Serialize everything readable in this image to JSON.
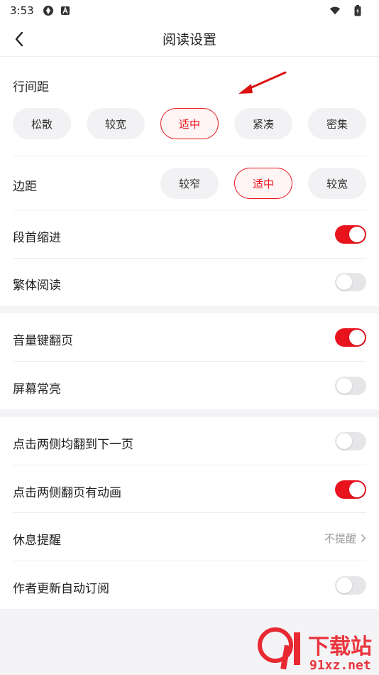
{
  "status_bar": {
    "time": "3:53"
  },
  "header": {
    "title": "阅读设置"
  },
  "line_spacing": {
    "label": "行间距",
    "options": [
      "松散",
      "较宽",
      "适中",
      "紧凑",
      "密集"
    ],
    "selected": "适中"
  },
  "margin": {
    "label": "边距",
    "options": [
      "较窄",
      "适中",
      "较宽"
    ],
    "selected": "适中"
  },
  "toggles": {
    "indent": {
      "label": "段首缩进",
      "on": true
    },
    "traditional": {
      "label": "繁体阅读",
      "on": false
    },
    "volume_flip": {
      "label": "音量键翻页",
      "on": true
    },
    "screen_on": {
      "label": "屏幕常亮",
      "on": false
    },
    "tap_next": {
      "label": "点击两侧均翻到下一页",
      "on": false
    },
    "tap_anim": {
      "label": "点击两侧翻页有动画",
      "on": true
    },
    "auto_subscribe": {
      "label": "作者更新自动订阅",
      "on": false
    }
  },
  "rest_reminder": {
    "label": "休息提醒",
    "value": "不提醒"
  },
  "watermark": {
    "brand": "下载站",
    "domain": "91xz.net"
  },
  "colors": {
    "accent": "#e8141d",
    "toggle_off": "#e6e6e8",
    "chip_bg": "#f2f2f4"
  }
}
